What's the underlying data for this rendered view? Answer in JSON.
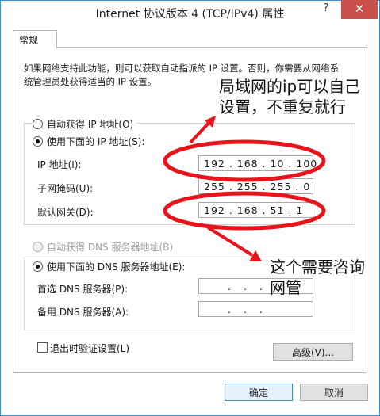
{
  "window": {
    "title": "Internet 协议版本 4 (TCP/IPv4) 属性",
    "help_glyph": "?",
    "close_glyph": "✕"
  },
  "tabs": [
    {
      "label": "常规"
    }
  ],
  "description": "如果网络支持此功能，则可以获取自动指派的 IP 设置。否则，你需要从网络系统管理员处获得适当的 IP 设置。",
  "ip_section": {
    "auto_option": "自动获得 IP 地址(O)",
    "manual_option": "使用下面的 IP 地址(S):",
    "ip_label": "IP 地址(I):",
    "ip_value": "192 . 168 . 10 . 100",
    "mask_label": "子网掩码(U):",
    "mask_value": "255 . 255 . 255 . 0",
    "gateway_label": "默认网关(D):",
    "gateway_value": "192 . 168 . 51 . 1"
  },
  "dns_section": {
    "auto_option": "自动获得 DNS 服务器地址(B)",
    "manual_option": "使用下面的 DNS 服务器地址(E):",
    "preferred_label": "首选 DNS 服务器(P):",
    "preferred_value": ".    .    .",
    "alternate_label": "备用 DNS 服务器(A):",
    "alternate_value": ".    .    ."
  },
  "validate_on_exit": "退出时验证设置(L)",
  "advanced_button": "高级(V)...",
  "ok_button": "确定",
  "cancel_button": "取消",
  "annotations": {
    "top": "局域网的ip可以自己设置，不重复就行",
    "bottom": "这个需要咨询网管"
  },
  "colors": {
    "title_border": "#3c8ec9",
    "close_button": "#c7504b",
    "annotation_red": "#e8141c"
  }
}
